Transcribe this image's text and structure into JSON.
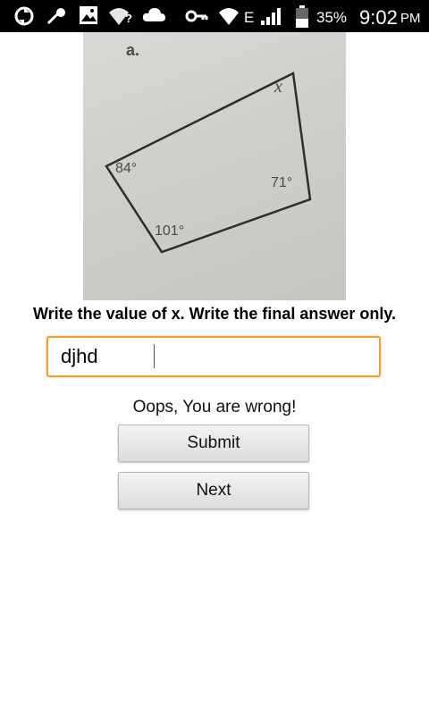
{
  "status_bar": {
    "battery_percent": "35%",
    "time": "9:02",
    "ampm": "PM",
    "network_type": "E",
    "wifi_unknown_mark": "?",
    "icons": [
      "sync-icon",
      "signal-off-icon",
      "image-icon",
      "wifi-question-icon",
      "cloud-icon",
      "key-icon",
      "wifi-icon",
      "cell-signal-icon",
      "battery-icon"
    ]
  },
  "photo": {
    "label_a": "a.",
    "angle_x": "x",
    "angle_84": "84°",
    "angle_71": "71°",
    "angle_101": "101°"
  },
  "question": {
    "text": "Write the value of x. Write the final answer only."
  },
  "answer": {
    "value": "djhd",
    "accent_color": "#f0a030"
  },
  "feedback": {
    "text": "Oops, You are wrong!"
  },
  "buttons": {
    "submit_label": "Submit",
    "next_label": "Next"
  }
}
